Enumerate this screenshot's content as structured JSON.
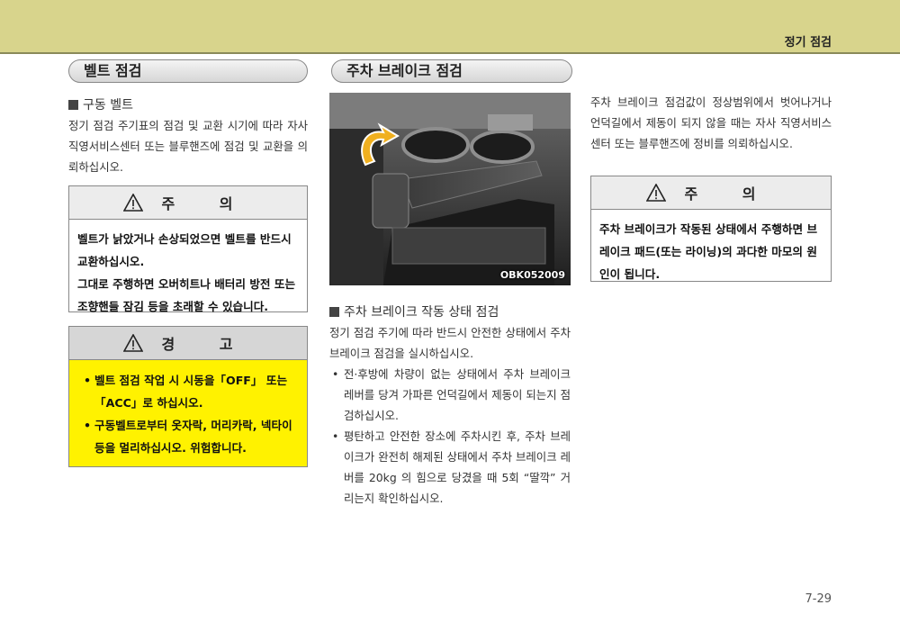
{
  "header": {
    "title": "정기 점검"
  },
  "left": {
    "section_title": "벨트 점검",
    "sub_heading": "구동 벨트",
    "paragraph": "정기 점검 주기표의 점검 및 교환 시기에 따라 자사 직영서비스센터 또는 블루핸즈에 점검 및 교환을 의뢰하십시오.",
    "caution": {
      "title": "주 의",
      "line1": "벨트가 낡았거나 손상되었으면 벨트를 반드시 교환하십시오.",
      "line2": "그대로 주행하면 오버히트나 배터리 방전 또는 조향핸들 잠김 등을 초래할 수 있습니다."
    },
    "warning": {
      "title": "경 고",
      "items": [
        "벨트 점검 작업 시 시동을「OFF」 또는「ACC」로 하십시오.",
        "구동벨트로부터 옷자락, 머리카락, 넥타이 등을 멀리하십시오. 위험합니다."
      ]
    }
  },
  "middle": {
    "section_title": "주차 브레이크 점검",
    "image_label": "OBK052009",
    "sub_heading": "주차 브레이크 작동 상태 점검",
    "paragraph": "정기 점검 주기에 따라 반드시 안전한 상태에서 주차 브레이크 점검을 실시하십시오.",
    "bullets": [
      "전·후방에 차량이 없는 상태에서 주차 브레이크 레버를 당겨 가파른 언덕길에서 제동이 되는지 점검하십시오.",
      "평탄하고 안전한 장소에 주차시킨 후, 주차 브레이크가 완전히 해제된 상태에서 주차 브레이크 레버를 20kg 의 힘으로 당겼을 때 5회 “딸깍” 거리는지 확인하십시오."
    ]
  },
  "right": {
    "paragraph": "주차 브레이크 점검값이 정상범위에서 벗어나거나 언덕길에서 제동이 되지 않을 때는 자사 직영서비스센터 또는 블루핸즈에 정비를 의뢰하십시오.",
    "caution": {
      "title": "주 의",
      "text": "주차 브레이크가 작동된 상태에서 주행하면 브레이크 패드(또는 라이닝)의 과다한 마모의 원인이 됩니다."
    }
  },
  "page_number": "7-29",
  "colors": {
    "header_band": "#d8d48c",
    "warning_fill": "#fff200"
  }
}
